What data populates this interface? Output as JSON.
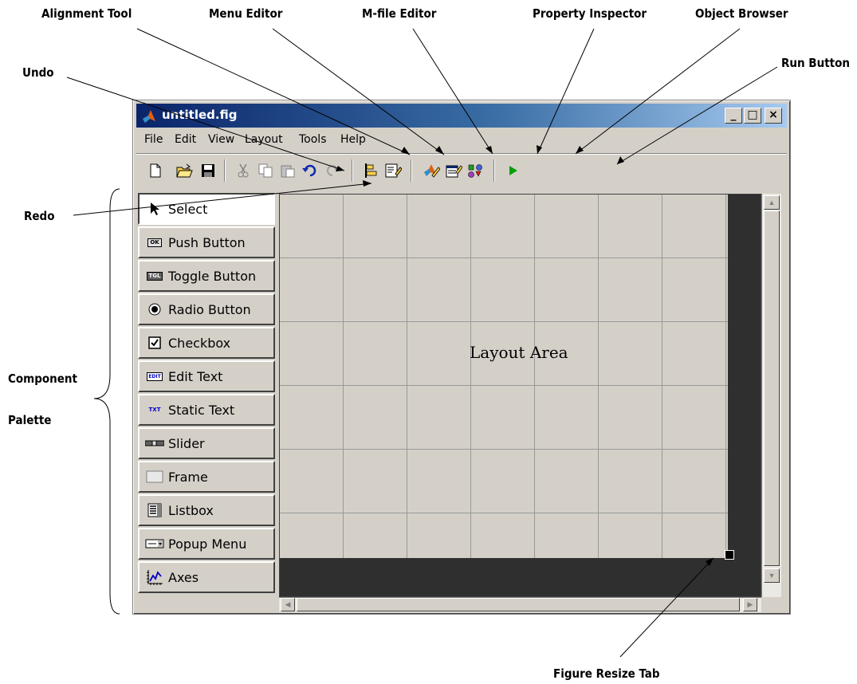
{
  "callouts": {
    "alignment_tool": "Alignment Tool",
    "menu_editor": "Menu Editor",
    "mfile_editor": "M-file Editor",
    "property_inspector": "Property Inspector",
    "object_browser": "Object Browser",
    "run_button": "Run Button",
    "undo": "Undo",
    "redo": "Redo",
    "component_palette_line1": "Component",
    "component_palette_line2": "Palette",
    "figure_resize_tab": "Figure Resize Tab"
  },
  "window": {
    "title": "untitled.fig",
    "minimize": "_",
    "maximize": "□",
    "close": "×"
  },
  "menubar": [
    "File",
    "Edit",
    "View",
    "Layout",
    "Tools",
    "Help"
  ],
  "toolbar_icons": [
    "new-icon",
    "open-icon",
    "save-icon",
    "cut-icon",
    "copy-icon",
    "paste-icon",
    "undo-icon",
    "redo-icon",
    "alignment-tool-icon",
    "menu-editor-icon",
    "mfile-editor-icon",
    "property-inspector-icon",
    "object-browser-icon",
    "run-icon"
  ],
  "palette": [
    {
      "label": "Select",
      "icon": "arrow-cursor-icon"
    },
    {
      "label": "Push Button",
      "icon": "push-button-icon"
    },
    {
      "label": "Toggle Button",
      "icon": "toggle-button-icon"
    },
    {
      "label": "Radio Button",
      "icon": "radio-button-icon"
    },
    {
      "label": "Checkbox",
      "icon": "checkbox-icon"
    },
    {
      "label": "Edit Text",
      "icon": "edit-text-icon"
    },
    {
      "label": "Static Text",
      "icon": "static-text-icon"
    },
    {
      "label": "Slider",
      "icon": "slider-icon"
    },
    {
      "label": "Frame",
      "icon": "frame-icon"
    },
    {
      "label": "Listbox",
      "icon": "listbox-icon"
    },
    {
      "label": "Popup Menu",
      "icon": "popup-menu-icon"
    },
    {
      "label": "Axes",
      "icon": "axes-icon"
    }
  ],
  "icon_text": {
    "push_button": "OK",
    "toggle_button": "TGL",
    "edit_text": "EDIT",
    "static_text": "TXT"
  },
  "layout_area": {
    "label": "Layout Area"
  },
  "colors": {
    "titlebar_start": "#0a246a",
    "titlebar_end": "#a6caf0",
    "face": "#d4d0c8",
    "run_green": "#00a000"
  }
}
